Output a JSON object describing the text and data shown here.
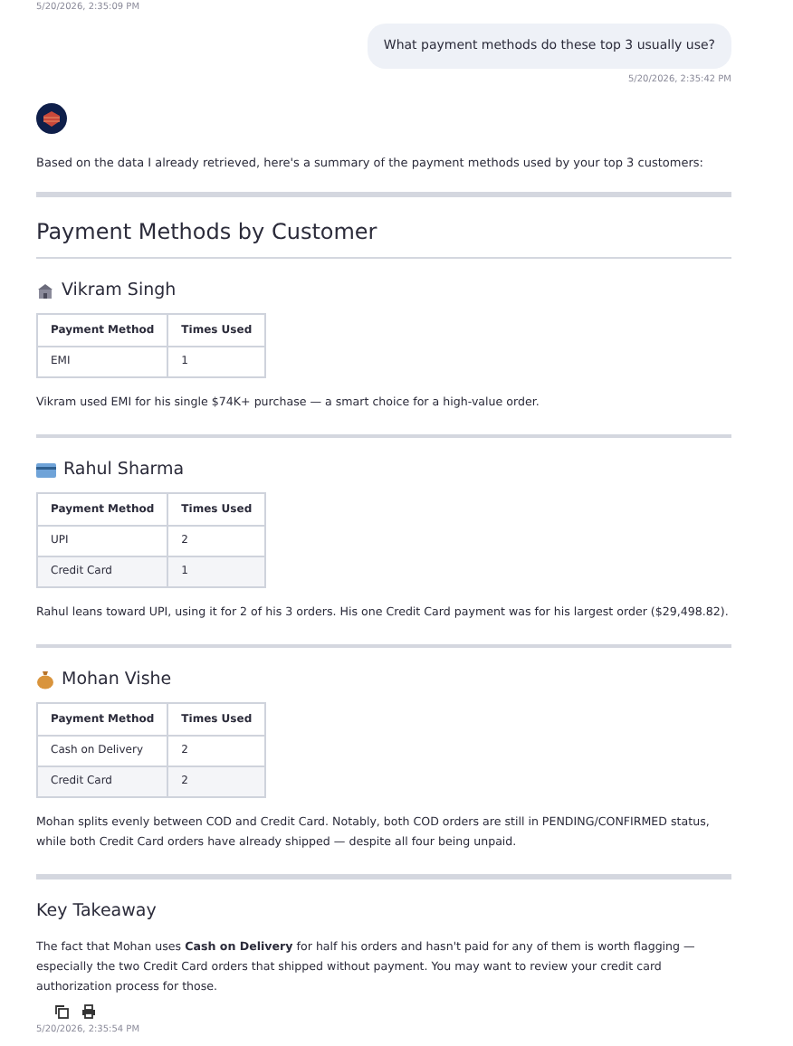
{
  "previous_timestamp": "5/20/2026, 2:35:09 PM",
  "user_message": {
    "text": "What payment methods do these top 3 usually use?",
    "timestamp": "5/20/2026, 2:35:42 PM"
  },
  "assistant": {
    "intro": "Based on the data I already retrieved, here's a summary of the payment methods used by your top 3 customers:",
    "heading": "Payment Methods by Customer",
    "customers": [
      {
        "name": "Vikram Singh",
        "columns": [
          "Payment Method",
          "Times Used"
        ],
        "rows": [
          [
            "EMI",
            "1"
          ]
        ],
        "note": "Vikram used EMI for his single $74K+ purchase — a smart choice for a high-value order."
      },
      {
        "name": "Rahul Sharma",
        "columns": [
          "Payment Method",
          "Times Used"
        ],
        "rows": [
          [
            "UPI",
            "2"
          ],
          [
            "Credit Card",
            "1"
          ]
        ],
        "note": "Rahul leans toward UPI, using it for 2 of his 3 orders. His one Credit Card payment was for his largest order ($29,498.82)."
      },
      {
        "name": "Mohan Vishe",
        "columns": [
          "Payment Method",
          "Times Used"
        ],
        "rows": [
          [
            "Cash on Delivery",
            "2"
          ],
          [
            "Credit Card",
            "2"
          ]
        ],
        "note": "Mohan splits evenly between COD and Credit Card. Notably, both COD orders are still in PENDING/CONFIRMED status, while both Credit Card orders have already shipped — despite all four being unpaid."
      }
    ],
    "takeaway_heading": "Key Takeaway",
    "takeaway": "The fact that Mohan uses **Cash on Delivery** for half his orders and hasn't paid for any of them is worth flagging — especially the two Credit Card orders that shipped without payment. You may want to review your credit card authorization process for those.",
    "timestamp": "5/20/2026, 2:35:54 PM"
  }
}
